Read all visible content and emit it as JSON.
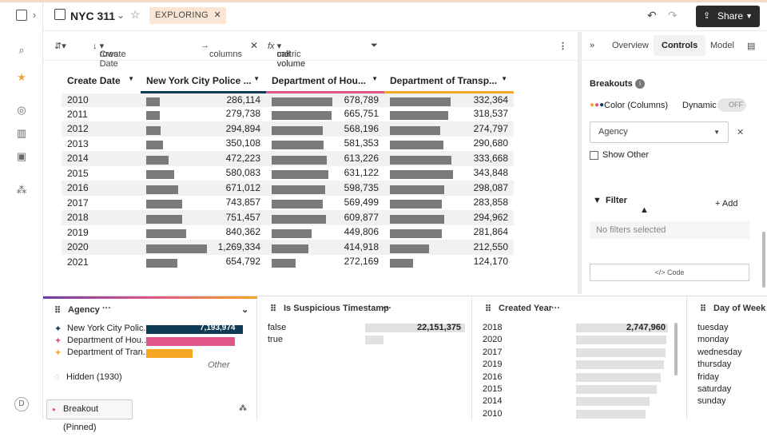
{
  "header": {
    "title": "NYC 311",
    "mode_badge": "EXPLORING",
    "share_label": "Share"
  },
  "toolbar": {
    "rows_label": "rows",
    "rows_value": "Create Date",
    "columns_label": "columns",
    "metric_label": "metric",
    "metric_value": "call volume"
  },
  "table": {
    "columns": [
      "Create Date",
      "New York City Police ...",
      "Department of Hou...",
      "Department of Transp..."
    ],
    "column_colors": [
      "#ffffff",
      "#0f3b57",
      "#e0568a",
      "#f5a623"
    ],
    "max": 1269334,
    "rows": [
      {
        "year": "2010",
        "v": [
          286114,
          678789,
          332364
        ],
        "t": [
          "286,114",
          "678,789",
          "332,364"
        ]
      },
      {
        "year": "2011",
        "v": [
          279738,
          665751,
          318537
        ],
        "t": [
          "279,738",
          "665,751",
          "318,537"
        ]
      },
      {
        "year": "2012",
        "v": [
          294894,
          568196,
          274797
        ],
        "t": [
          "294,894",
          "568,196",
          "274,797"
        ]
      },
      {
        "year": "2013",
        "v": [
          350108,
          581353,
          290680
        ],
        "t": [
          "350,108",
          "581,353",
          "290,680"
        ]
      },
      {
        "year": "2014",
        "v": [
          472223,
          613226,
          333668
        ],
        "t": [
          "472,223",
          "613,226",
          "333,668"
        ]
      },
      {
        "year": "2015",
        "v": [
          580083,
          631122,
          343848
        ],
        "t": [
          "580,083",
          "631,122",
          "343,848"
        ]
      },
      {
        "year": "2016",
        "v": [
          671012,
          598735,
          298087
        ],
        "t": [
          "671,012",
          "598,735",
          "298,087"
        ]
      },
      {
        "year": "2017",
        "v": [
          743857,
          569499,
          283858
        ],
        "t": [
          "743,857",
          "569,499",
          "283,858"
        ]
      },
      {
        "year": "2018",
        "v": [
          751457,
          609877,
          294962
        ],
        "t": [
          "751,457",
          "609,877",
          "294,962"
        ]
      },
      {
        "year": "2019",
        "v": [
          840362,
          449806,
          281864
        ],
        "t": [
          "840,362",
          "449,806",
          "281,864"
        ]
      },
      {
        "year": "2020",
        "v": [
          1269334,
          414918,
          212550
        ],
        "t": [
          "1,269,334",
          "414,918",
          "212,550"
        ]
      },
      {
        "year": "2021",
        "v": [
          654792,
          272169,
          124170
        ],
        "t": [
          "654,792",
          "272,169",
          "124,170"
        ]
      }
    ]
  },
  "panel": {
    "tabs": [
      "Overview",
      "Controls",
      "Model"
    ],
    "breakouts_label": "Breakouts",
    "color_label": "Color (Columns)",
    "dynamic_label": "Dynamic",
    "toggle_label": "OFF",
    "select_value": "Agency",
    "show_other_label": "Show Other",
    "filter_label": "Filter",
    "add_label": "Add",
    "no_filters": "No filters selected",
    "code_label": "Code"
  },
  "cards": {
    "agency": {
      "title": "Agency",
      "items": [
        {
          "label": "New York City Polic...",
          "value": "7,193,974",
          "fill": 1.0,
          "color": "#0f3b57"
        },
        {
          "label": "Department of Hou...",
          "value": "",
          "fill": 0.92,
          "color": "#e0568a"
        },
        {
          "label": "Department of Tran...",
          "value": "",
          "fill": 0.48,
          "color": "#f5a623"
        }
      ],
      "other_label": "Other",
      "hidden_label": "Hidden (1930)",
      "breakout_label": "Breakout (Pinned)"
    },
    "suspicious": {
      "title": "Is Suspicious Timestamp",
      "items": [
        {
          "label": "false",
          "value": "22,151,375",
          "fill": 1.0
        },
        {
          "label": "true",
          "value": "",
          "fill": 0.18
        }
      ]
    },
    "year": {
      "title": "Created Year",
      "items": [
        {
          "label": "2018",
          "value": "2,747,960",
          "fill": 1.0
        },
        {
          "label": "2020",
          "value": "",
          "fill": 0.98
        },
        {
          "label": "2017",
          "value": "",
          "fill": 0.97
        },
        {
          "label": "2019",
          "value": "",
          "fill": 0.96
        },
        {
          "label": "2016",
          "value": "",
          "fill": 0.92
        },
        {
          "label": "2015",
          "value": "",
          "fill": 0.88
        },
        {
          "label": "2014",
          "value": "",
          "fill": 0.8
        },
        {
          "label": "2010",
          "value": "",
          "fill": 0.76
        }
      ]
    },
    "dow": {
      "title": "Day of Week",
      "items": [
        "tuesday",
        "monday",
        "wednesday",
        "thursday",
        "friday",
        "saturday",
        "sunday"
      ]
    }
  }
}
